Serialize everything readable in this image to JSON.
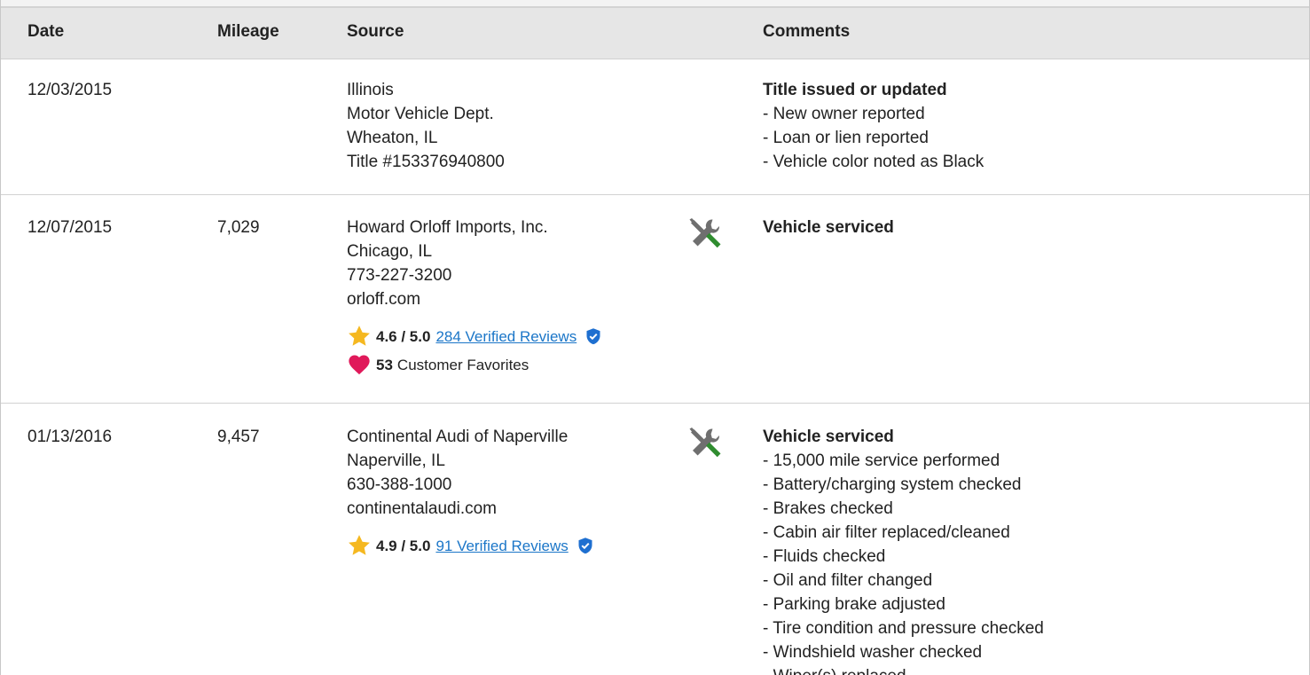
{
  "columns": [
    "Date",
    "Mileage",
    "Source",
    "Comments"
  ],
  "colors": {
    "header_bg": "#e6e6e6",
    "link": "#1b76c8",
    "star": "#f5b820",
    "heart": "#e0195a",
    "shield": "#1e6fd0",
    "wrench": "#6f6f6f",
    "screwdriver": "#2f8c2f"
  },
  "rows": [
    {
      "date": "12/03/2015",
      "mileage": "",
      "source": [
        "Illinois",
        "Motor Vehicle Dept.",
        "Wheaton, IL",
        "Title #153376940800"
      ],
      "service_icon": false,
      "comment_title": "Title issued or updated",
      "comments": [
        "- New owner reported",
        "- Loan or lien reported",
        "- Vehicle color noted as Black"
      ]
    },
    {
      "date": "12/07/2015",
      "mileage": "7,029",
      "source": [
        "Howard Orloff Imports, Inc.",
        "Chicago, IL",
        "773-227-3200",
        "orloff.com"
      ],
      "service_icon": true,
      "rating": {
        "score": "4.6 / 5.0",
        "reviews_link": "284 Verified Reviews"
      },
      "favorites": {
        "count": "53",
        "label": "Customer Favorites"
      },
      "comment_title": "Vehicle serviced",
      "comments": []
    },
    {
      "date": "01/13/2016",
      "mileage": "9,457",
      "source": [
        "Continental Audi of Naperville",
        "Naperville, IL",
        "630-388-1000",
        "continentalaudi.com"
      ],
      "service_icon": true,
      "rating": {
        "score": "4.9 / 5.0",
        "reviews_link": "91 Verified Reviews"
      },
      "comment_title": "Vehicle serviced",
      "comments": [
        "- 15,000 mile service performed",
        "- Battery/charging system checked",
        "- Brakes checked",
        "- Cabin air filter replaced/cleaned",
        "- Fluids checked",
        "- Oil and filter changed",
        "- Parking brake adjusted",
        "- Tire condition and pressure checked",
        "- Windshield washer checked",
        "- Wiper(s) replaced"
      ]
    }
  ]
}
